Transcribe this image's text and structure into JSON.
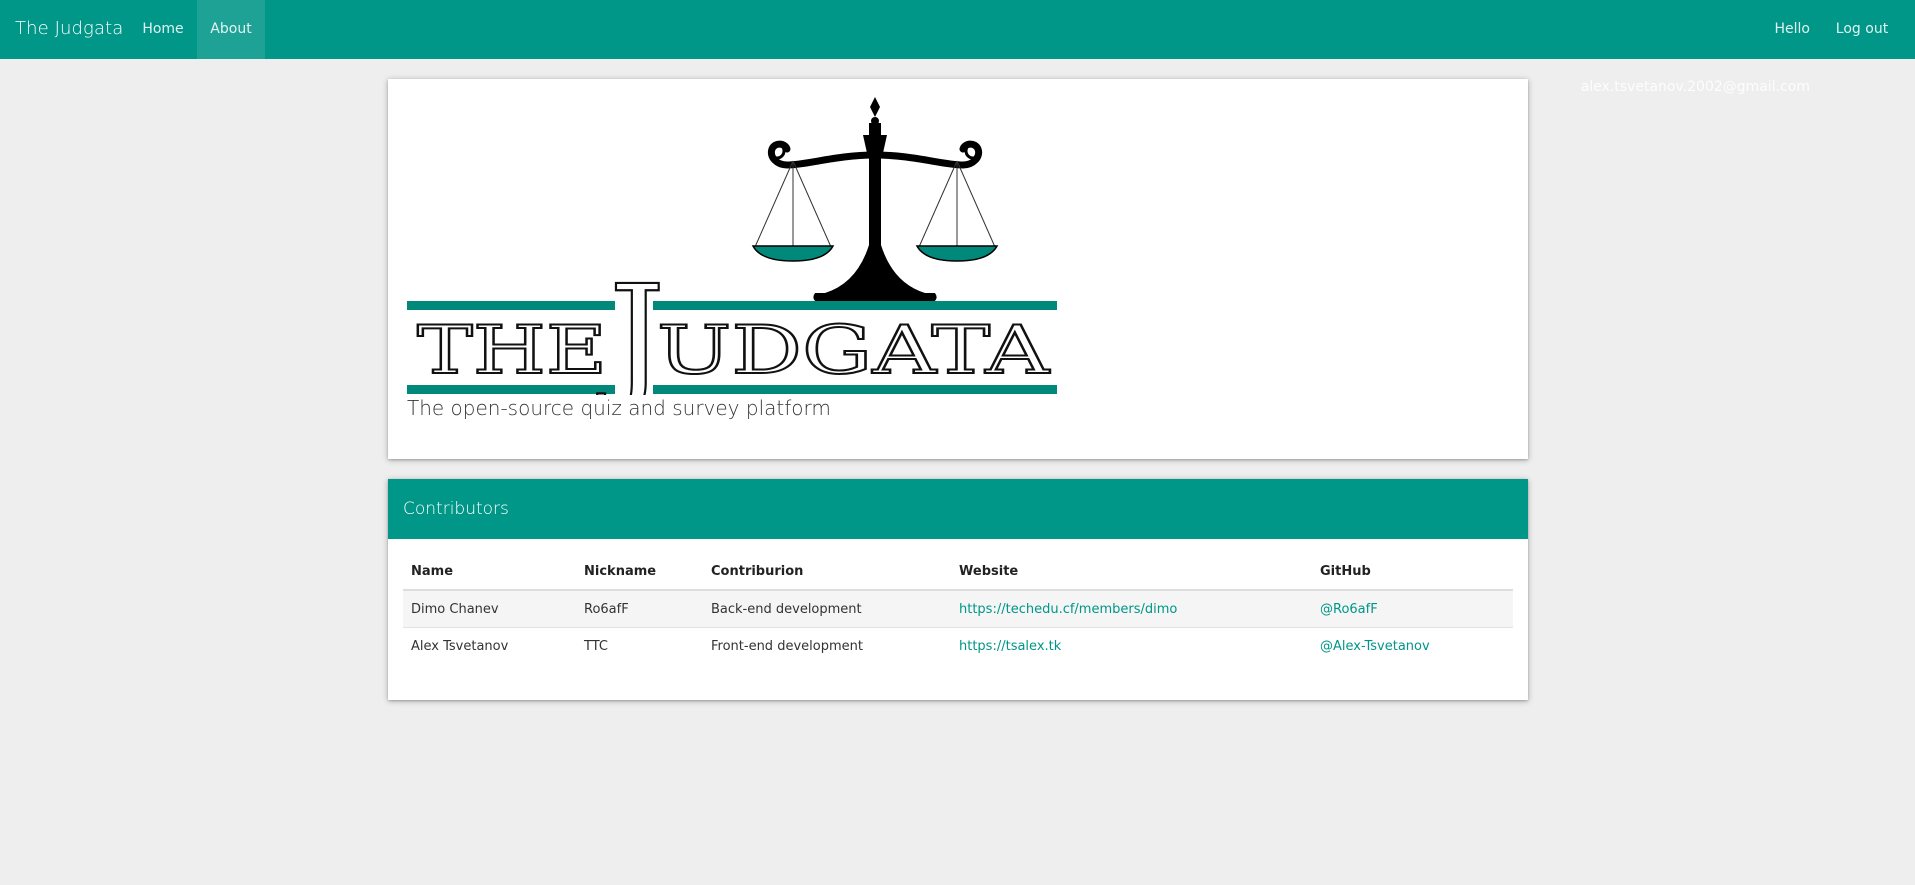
{
  "navbar": {
    "brand": "The Judgata",
    "links": [
      "Home",
      "About"
    ],
    "active": "About",
    "greeting": "Hello alex.tsvetanov.2002@gmail.com",
    "logout": "Log out",
    "color": "#009688"
  },
  "hero": {
    "logo_text": "THE JUDGATA",
    "tagline": "The open-source quiz and survey platform"
  },
  "contributors": {
    "heading": "Contributors",
    "columns": [
      "Name",
      "Nickname",
      "Contriburion",
      "Website",
      "GitHub"
    ],
    "rows": [
      {
        "name": "Dimo Chanev",
        "nickname": "Ro6afF",
        "contribution": "Back-end development",
        "website": "https://techedu.cf/members/dimo",
        "github": "@Ro6afF"
      },
      {
        "name": "Alex Tsvetanov",
        "nickname": "TTC",
        "contribution": "Front-end development",
        "website": "https://tsalex.tk",
        "github": "@Alex-Tsvetanov"
      }
    ]
  }
}
